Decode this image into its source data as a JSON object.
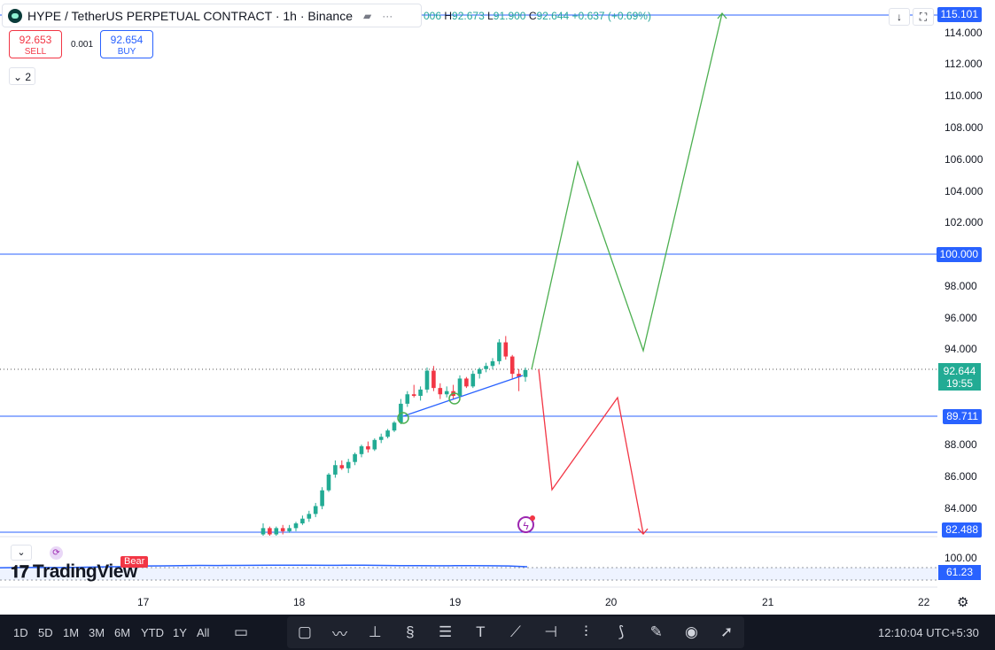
{
  "header": {
    "symbol_title": "HYPE / TetherUS PERPETUAL CONTRACT · 1h · Binance",
    "ohlc_prefix": "006",
    "high_label": "H",
    "high": "92.673",
    "low_label": "L",
    "low": "91.900",
    "close_label": "C",
    "close": "92.644",
    "change": "+0.637 (+0.69%)"
  },
  "trade": {
    "sell_price": "92.653",
    "sell_label": "SELL",
    "spread": "0.001",
    "buy_price": "92.654",
    "buy_label": "BUY"
  },
  "indicators_count": "2",
  "price_axis": {
    "ticks": [
      "114.000",
      "112.000",
      "110.000",
      "108.000",
      "106.000",
      "104.000",
      "102.000",
      "98.000",
      "96.000",
      "94.000",
      "88.000",
      "86.000",
      "84.000"
    ],
    "top_level": "115.101",
    "level_100": "100.000",
    "level_89": "89.711",
    "level_82": "82.488",
    "current_price": "92.644",
    "countdown": "19:55"
  },
  "rsi": {
    "value": "61.23",
    "top_tick": "100.00",
    "tag": "Bear"
  },
  "time_axis": [
    "17",
    "18",
    "19",
    "20",
    "21",
    "22"
  ],
  "branding": "TradingView",
  "timeframes": [
    "1D",
    "5D",
    "1M",
    "3M",
    "6M",
    "YTD",
    "1Y",
    "All"
  ],
  "clock": "12:10:04 UTC+5:30",
  "colors": {
    "up": "#22ab94",
    "down": "#f23645",
    "level_line": "#2962ff",
    "bull_path": "#4caf50",
    "bear_path": "#f23645"
  },
  "icons": {
    "tools": [
      "rectangle-icon",
      "path-icon",
      "long-position-icon",
      "short-position-icon",
      "fib-icon",
      "text-icon",
      "trendline-icon",
      "projection-icon",
      "bars-pattern-icon",
      "pitchfork-icon",
      "brush-icon",
      "circle-icon",
      "arrow-icon"
    ]
  },
  "chart_data": {
    "type": "candlestick",
    "ylim": [
      82.488,
      115.101
    ],
    "horizontal_levels": [
      115.101,
      100.0,
      89.711,
      82.488
    ],
    "current_price": 92.644,
    "candles_ohlc": [
      [
        82.2,
        82.9,
        82.1,
        82.6
      ],
      [
        82.6,
        82.7,
        82.0,
        82.2
      ],
      [
        82.2,
        82.7,
        82.1,
        82.6
      ],
      [
        82.6,
        82.8,
        82.2,
        82.4
      ],
      [
        82.4,
        82.8,
        82.3,
        82.6
      ],
      [
        82.6,
        83.0,
        82.4,
        82.9
      ],
      [
        82.9,
        83.4,
        82.8,
        83.2
      ],
      [
        83.2,
        83.7,
        83.0,
        83.5
      ],
      [
        83.5,
        84.2,
        83.3,
        84.0
      ],
      [
        84.0,
        85.2,
        83.8,
        85.0
      ],
      [
        85.0,
        86.1,
        84.9,
        86.0
      ],
      [
        86.0,
        86.9,
        85.8,
        86.6
      ],
      [
        86.6,
        86.9,
        86.3,
        86.4
      ],
      [
        86.4,
        87.0,
        86.1,
        86.8
      ],
      [
        86.8,
        87.4,
        86.6,
        87.3
      ],
      [
        87.3,
        87.9,
        87.1,
        87.8
      ],
      [
        87.8,
        88.1,
        87.4,
        87.6
      ],
      [
        87.6,
        88.3,
        87.5,
        88.2
      ],
      [
        88.2,
        88.6,
        88.0,
        88.4
      ],
      [
        88.4,
        88.9,
        88.3,
        88.8
      ],
      [
        88.8,
        89.4,
        88.7,
        89.3
      ],
      [
        89.3,
        90.8,
        89.2,
        90.5
      ],
      [
        90.5,
        91.3,
        90.3,
        91.1
      ],
      [
        91.1,
        91.7,
        90.9,
        91.0
      ],
      [
        91.0,
        91.6,
        90.7,
        91.4
      ],
      [
        91.4,
        92.8,
        91.2,
        92.6
      ],
      [
        92.6,
        92.9,
        91.3,
        91.5
      ],
      [
        91.5,
        91.8,
        90.8,
        91.1
      ],
      [
        91.1,
        91.6,
        90.9,
        91.3
      ],
      [
        91.3,
        91.7,
        90.8,
        91.0
      ],
      [
        91.0,
        92.3,
        90.9,
        92.1
      ],
      [
        92.1,
        92.2,
        91.5,
        91.6
      ],
      [
        91.6,
        92.6,
        91.5,
        92.4
      ],
      [
        92.4,
        92.8,
        92.1,
        92.7
      ],
      [
        92.7,
        93.1,
        92.5,
        92.9
      ],
      [
        92.9,
        93.4,
        92.7,
        93.2
      ],
      [
        93.2,
        94.6,
        93.0,
        94.4
      ],
      [
        94.4,
        94.8,
        93.3,
        93.5
      ],
      [
        93.5,
        93.6,
        92.1,
        92.4
      ],
      [
        92.4,
        92.7,
        91.3,
        92.2
      ],
      [
        92.2,
        92.8,
        91.9,
        92.644
      ]
    ],
    "bullish_path": [
      [
        0,
        92.6
      ],
      [
        1,
        105.8
      ],
      [
        2,
        93.9
      ],
      [
        3,
        115.1
      ]
    ],
    "bearish_path": [
      [
        0,
        92.6
      ],
      [
        1,
        85.1
      ],
      [
        2,
        89.5
      ],
      [
        3,
        82.3
      ]
    ],
    "trendline": [
      [
        0,
        89.6
      ],
      [
        1,
        92.1
      ]
    ],
    "rsi_series": [
      58,
      58.5,
      59,
      58.7,
      59.3,
      60,
      61,
      62,
      63.5,
      64,
      64.8,
      65.2,
      65,
      65.3,
      65.5,
      65.8,
      66,
      65.7,
      65.6,
      65.9,
      66.2,
      65.4,
      64.8,
      64.5,
      64.2,
      64.4,
      64.6,
      64.1,
      63.5,
      61.23
    ]
  }
}
